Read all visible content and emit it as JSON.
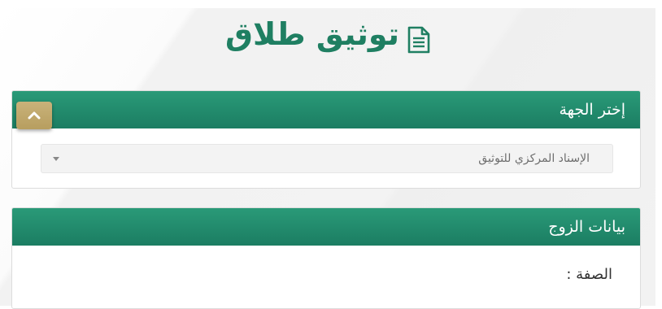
{
  "page": {
    "title": "توثيق طلاق",
    "title_icon": "document-icon"
  },
  "entity_panel": {
    "header": "إختر الجهة",
    "select_value": "الإسناد المركزي للتوثيق",
    "collapse_icon": "chevron-up-icon"
  },
  "husband_panel": {
    "header": "بيانات الزوج",
    "field_label": "الصفة :"
  },
  "colors": {
    "accent": "#1f7f62",
    "header_bg": "#23906e",
    "collapse_button": "#c2aa6e"
  }
}
